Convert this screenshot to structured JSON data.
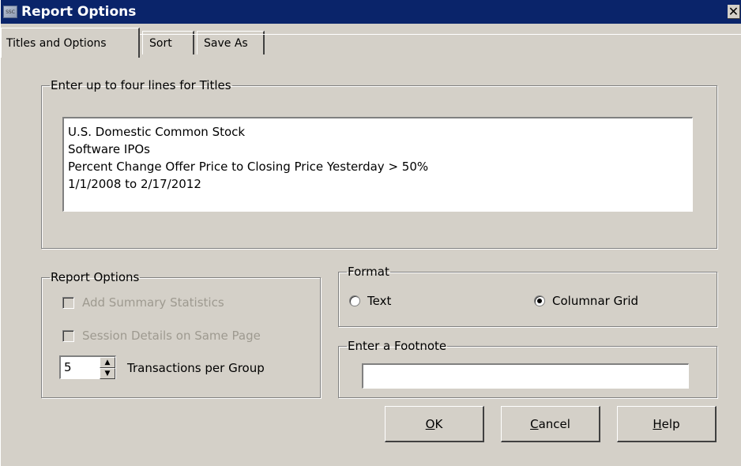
{
  "window": {
    "title": "Report Options",
    "icon_text": "SSC",
    "close_glyph": "✕"
  },
  "tabs": [
    {
      "label": "Titles and Options",
      "active": true
    },
    {
      "label": "Sort",
      "active": false
    },
    {
      "label": "Save As",
      "active": false
    }
  ],
  "titles": {
    "group_label": "Enter up to four lines for Titles",
    "lines": [
      "U.S. Domestic Common Stock",
      "Software IPOs",
      "Percent Change Offer Price to Closing Price Yesterday > 50%",
      "1/1/2008 to 2/17/2012"
    ]
  },
  "report_options": {
    "group_label": "Report Options",
    "add_summary_statistics": {
      "label": "Add Summary Statistics",
      "checked": false,
      "enabled": false
    },
    "session_details": {
      "label": "Session Details on Same Page",
      "checked": false,
      "enabled": false
    },
    "transactions_per_group": {
      "value": "5",
      "label": "Transactions per Group"
    }
  },
  "format": {
    "group_label": "Format",
    "options": [
      {
        "label": "Text",
        "selected": false
      },
      {
        "label": "Columnar Grid",
        "selected": true
      }
    ]
  },
  "footnote": {
    "group_label": "Enter a Footnote",
    "value": ""
  },
  "buttons": {
    "ok": {
      "mnemonic": "O",
      "rest": "K"
    },
    "cancel": {
      "mnemonic": "C",
      "rest": "ancel"
    },
    "help": {
      "mnemonic": "H",
      "rest": "elp"
    }
  },
  "colors": {
    "titlebar": "#0a246a",
    "face": "#d4d0c8",
    "disabled_text": "#9e9a90"
  }
}
